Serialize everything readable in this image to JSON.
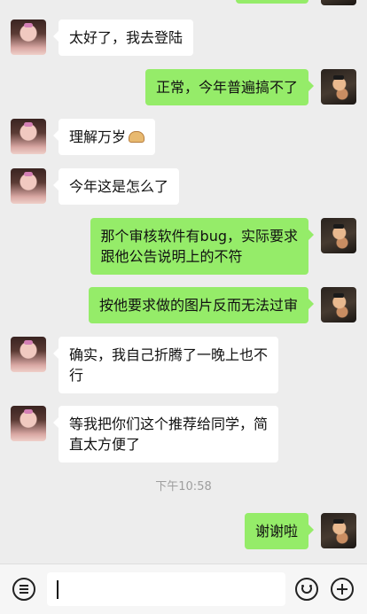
{
  "messages": [
    {
      "side": "left",
      "text": "太好了，我去登陆"
    },
    {
      "side": "right",
      "text": "正常，今年普遍搞不了"
    },
    {
      "side": "left",
      "text": "理解万岁",
      "emoji": "mooncake-emoji"
    },
    {
      "side": "left",
      "text": "今年这是怎么了"
    },
    {
      "side": "right",
      "line1": "那个审核软件有bug，实际要求",
      "line2": "跟他公告说明上的不符"
    },
    {
      "side": "right",
      "text": "按他要求做的图片反而无法过审"
    },
    {
      "side": "left",
      "line1": "确实，我自己折腾了一晚上也不",
      "line2": "行"
    },
    {
      "side": "left",
      "line1": "等我把你们这个推荐给同学，简",
      "line2": "直太方便了"
    },
    {
      "side": "right",
      "text": "谢谢啦"
    }
  ],
  "timestamp": "下午10:58",
  "input_bar": {
    "value": "",
    "left_icon": "voice-icon",
    "right_icons": [
      "emoji-icon",
      "plus-icon"
    ]
  },
  "colors": {
    "background": "#ededed",
    "own_bubble": "#95ec69",
    "other_bubble": "#ffffff",
    "timestamp_text": "#9e9e9e"
  }
}
